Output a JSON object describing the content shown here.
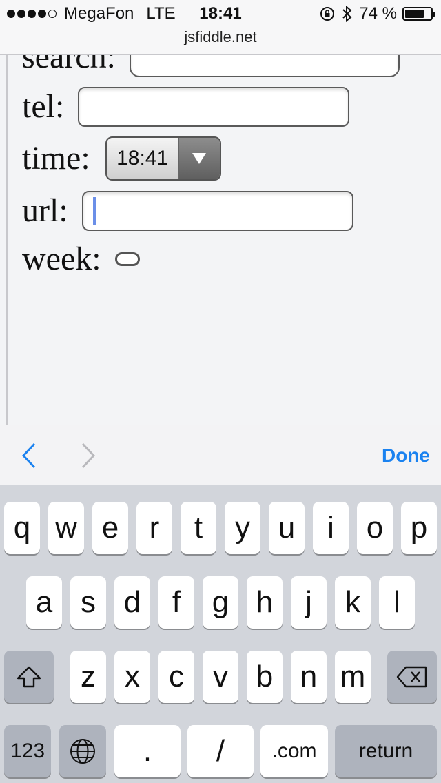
{
  "status_bar": {
    "carrier": "MegaFon",
    "network": "LTE",
    "time": "18:41",
    "url": "jsfiddle.net",
    "battery_text": "74 %",
    "battery_level": 0.74
  },
  "form": {
    "search_label": "search:",
    "tel_label": "tel:",
    "time_label": "time:",
    "time_value": "18:41",
    "url_label": "url:",
    "week_label": "week:"
  },
  "accessory": {
    "done_label": "Done"
  },
  "keyboard": {
    "row1": [
      "q",
      "w",
      "e",
      "r",
      "t",
      "y",
      "u",
      "i",
      "o",
      "p"
    ],
    "row2": [
      "a",
      "s",
      "d",
      "f",
      "g",
      "h",
      "j",
      "k",
      "l"
    ],
    "row3": [
      "z",
      "x",
      "c",
      "v",
      "b",
      "n",
      "m"
    ],
    "numbers_label": "123",
    "dot_label": ".",
    "slash_label": "/",
    "dotcom_label": ".com",
    "return_label": "return"
  }
}
